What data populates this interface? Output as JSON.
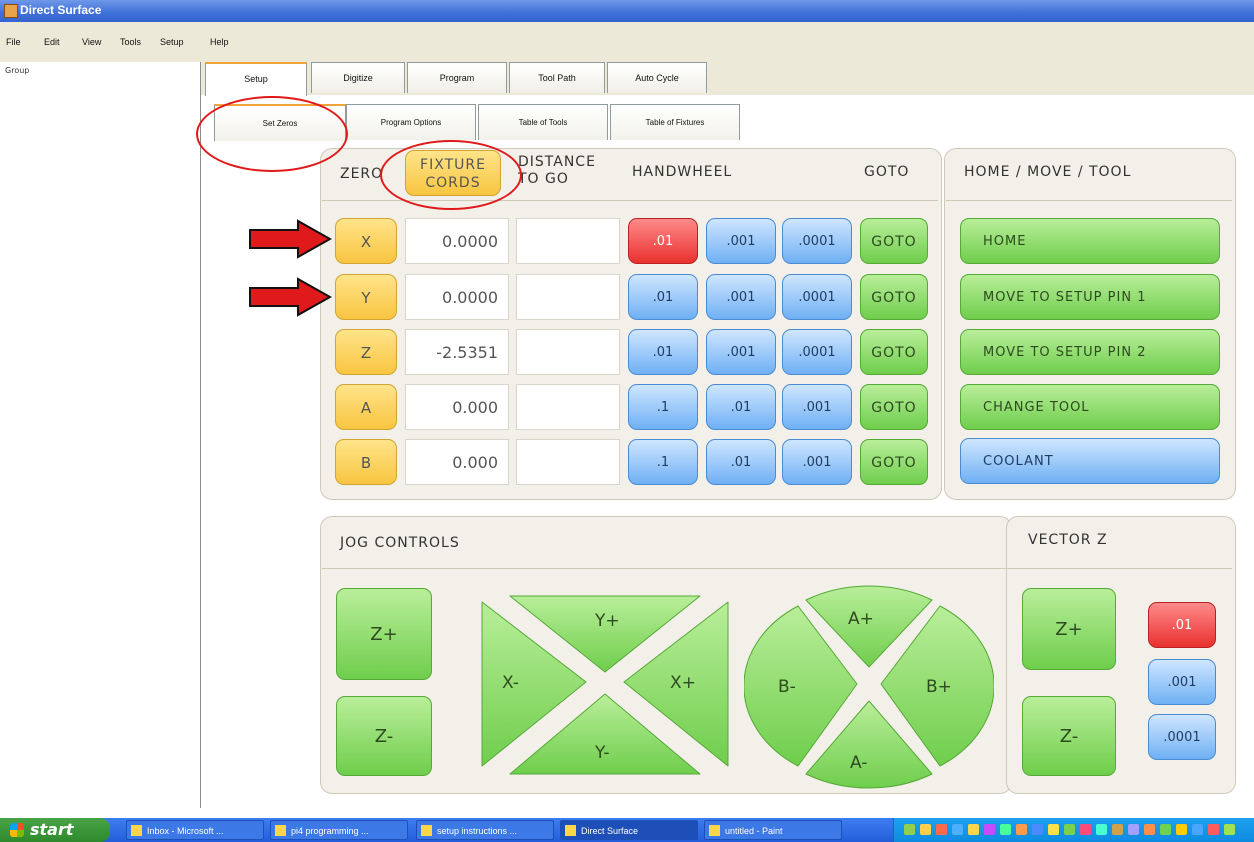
{
  "window": {
    "title": "Direct Surface"
  },
  "menu": [
    "File",
    "Edit",
    "View",
    "Tools",
    "Setup",
    "Help"
  ],
  "left_panel": {
    "label": "Group"
  },
  "tabs": [
    "Setup",
    "Digitize",
    "Program",
    "Tool Path",
    "Auto Cycle"
  ],
  "subtabs": [
    "Set Zeros",
    "Program Options",
    "Table of Tools",
    "Table of Fixtures"
  ],
  "headers": {
    "zero": "ZERO",
    "fixture_l1": "FIXTURE",
    "fixture_l2": "CORDS",
    "distance_l1": "DISTANCE",
    "distance_l2": "TO GO",
    "handwheel": "HANDWHEEL",
    "goto": "GOTO",
    "home_move_tool": "HOME / MOVE / TOOL",
    "jog_controls": "JOG CONTROLS",
    "vector_z": "VECTOR Z"
  },
  "axes": [
    {
      "axis": "X",
      "value": "0.0000",
      "steps": [
        ".01",
        ".001",
        ".0001"
      ],
      "active_step": 0,
      "goto": "GOTO"
    },
    {
      "axis": "Y",
      "value": "0.0000",
      "steps": [
        ".01",
        ".001",
        ".0001"
      ],
      "active_step": -1,
      "goto": "GOTO"
    },
    {
      "axis": "Z",
      "value": "-2.5351",
      "steps": [
        ".01",
        ".001",
        ".0001"
      ],
      "active_step": -1,
      "goto": "GOTO"
    },
    {
      "axis": "A",
      "value": "0.000",
      "steps": [
        ".1",
        ".01",
        ".001"
      ],
      "active_step": -1,
      "goto": "GOTO"
    },
    {
      "axis": "B",
      "value": "0.000",
      "steps": [
        ".1",
        ".01",
        ".001"
      ],
      "active_step": -1,
      "goto": "GOTO"
    }
  ],
  "home_buttons": [
    "HOME",
    "MOVE TO SETUP PIN 1",
    "MOVE TO SETUP PIN 2",
    "CHANGE TOOL",
    "COOLANT"
  ],
  "jog": {
    "z_plus": "Z+",
    "z_minus": "Z-",
    "y_plus": "Y+",
    "y_minus": "Y-",
    "x_minus": "X-",
    "x_plus": "X+",
    "a_plus": "A+",
    "a_minus": "A-",
    "b_minus": "B-",
    "b_plus": "B+"
  },
  "vector_z": {
    "z_plus": "Z+",
    "z_minus": "Z-",
    "steps": [
      ".01",
      ".001",
      ".0001"
    ],
    "active_step": 0
  },
  "taskbar": {
    "start": "start",
    "tasks": [
      "Inbox - Microsoft ...",
      "pi4 programming ...",
      "setup instructions ...",
      "Direct Surface",
      "untitled - Paint"
    ],
    "active_task": 3
  },
  "colors": {
    "yellow": "#f8c540",
    "green": "#6fce4c",
    "blue": "#6fb0f4",
    "red": "#e9312f",
    "annotation_red": "#e01a1a"
  }
}
